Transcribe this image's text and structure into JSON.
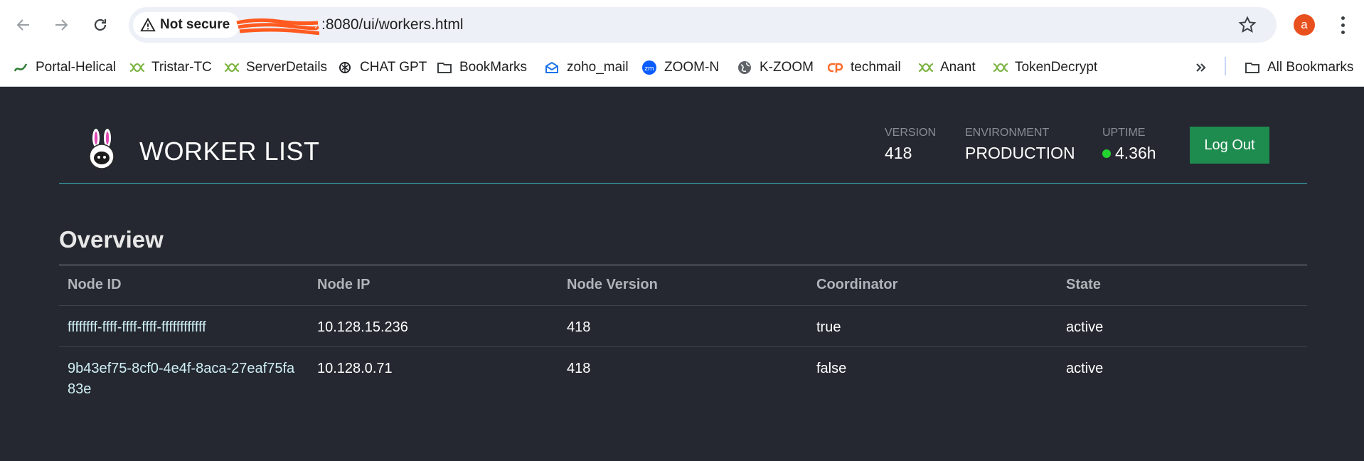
{
  "browser": {
    "security_label": "Not secure",
    "url_suffix": ":8080/ui/workers.html",
    "profile_initial": "a",
    "bookmarks": [
      {
        "label": "Portal-Helical",
        "icon": "helical-logo-icon"
      },
      {
        "label": "Tristar-TC",
        "icon": "dna-icon"
      },
      {
        "label": "ServerDetails",
        "icon": "dna-icon"
      },
      {
        "label": "CHAT GPT",
        "icon": "openai-icon"
      },
      {
        "label": "BookMarks",
        "icon": "folder-icon"
      },
      {
        "label": "zoho_mail",
        "icon": "mail-icon"
      },
      {
        "label": "ZOOM-N",
        "icon": "zoom-icon"
      },
      {
        "label": "K-ZOOM",
        "icon": "globe-icon"
      },
      {
        "label": "techmail",
        "icon": "cpanel-icon"
      },
      {
        "label": "Anant",
        "icon": "dna-icon"
      },
      {
        "label": "TokenDecrypt",
        "icon": "dna-icon"
      }
    ],
    "all_bookmarks_label": "All Bookmarks"
  },
  "header": {
    "title": "WORKER LIST",
    "version_label": "VERSION",
    "version_value": "418",
    "environment_label": "ENVIRONMENT",
    "environment_value": "PRODUCTION",
    "uptime_label": "UPTIME",
    "uptime_value": "4.36h",
    "uptime_status_color": "#23d330",
    "logout_label": "Log Out"
  },
  "overview": {
    "title": "Overview",
    "columns": [
      "Node ID",
      "Node IP",
      "Node Version",
      "Coordinator",
      "State"
    ],
    "rows": [
      {
        "node_id": "ffffffff-ffff-ffff-ffff-ffffffffffff",
        "node_ip": "10.128.15.236",
        "version": "418",
        "coordinator": "true",
        "state": "active"
      },
      {
        "node_id": "9b43ef75-8cf0-4e4f-8aca-27eaf75fa83e",
        "node_ip": "10.128.0.71",
        "version": "418",
        "coordinator": "false",
        "state": "active"
      }
    ]
  },
  "colors": {
    "background": "#252830",
    "accent_line": "#3fb6c4",
    "logout_button": "#1e8b4f"
  }
}
